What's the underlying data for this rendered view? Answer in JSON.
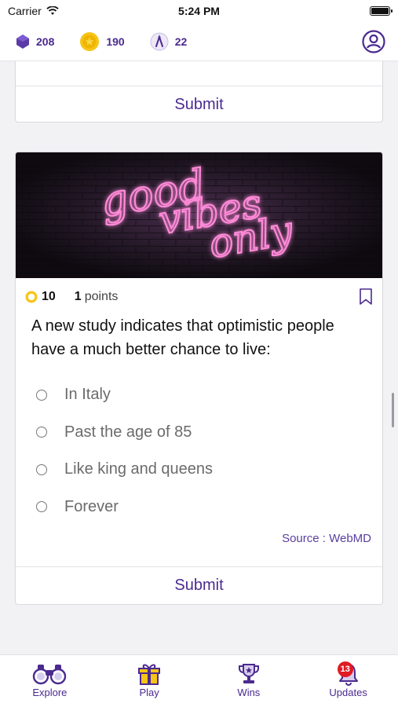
{
  "status": {
    "carrier": "Carrier",
    "time": "5:24 PM"
  },
  "stats": {
    "gems": "208",
    "coins": "190",
    "tokens": "22"
  },
  "card_previous": {
    "submit_label": "Submit"
  },
  "quiz": {
    "banner_text_1": "good",
    "banner_text_2": "vibes",
    "banner_text_3": "only",
    "coin_reward": "10",
    "points_value": "1",
    "points_label": "points",
    "question": "A new study indicates that optimistic people have a much better chance to live:",
    "options": [
      "In Italy",
      "Past the age of 85",
      "Like king and queens",
      "Forever"
    ],
    "source": "Source : WebMD",
    "submit_label": "Submit"
  },
  "tabs": [
    {
      "label": "Explore",
      "icon": "binoculars-icon"
    },
    {
      "label": "Play",
      "icon": "gift-icon"
    },
    {
      "label": "Wins",
      "icon": "trophy-icon"
    },
    {
      "label": "Updates",
      "icon": "bell-icon",
      "badge": "13"
    }
  ],
  "colors": {
    "accent": "#4b2a8f",
    "badge": "#e01b24",
    "coin": "#f5c518",
    "neon": "#ff8ad8"
  }
}
